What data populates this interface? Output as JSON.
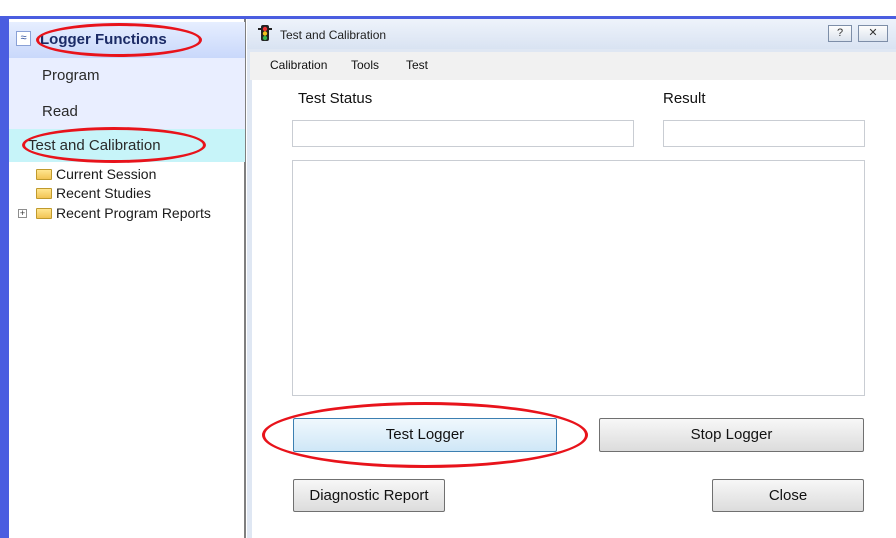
{
  "sidebar": {
    "header": {
      "collapse_glyph": "≈",
      "title": "Logger Functions"
    },
    "nav": [
      {
        "label": "Program"
      },
      {
        "label": "Read"
      },
      {
        "label": "Test and Calibration"
      }
    ],
    "tree": [
      {
        "label": "Current Session",
        "icon": "folder-icon"
      },
      {
        "label": "Recent Studies",
        "icon": "folder-icon"
      },
      {
        "label": "Recent Program Reports",
        "icon": "folder-icon",
        "expander": "+"
      }
    ]
  },
  "dialog": {
    "title": "Test and Calibration",
    "help_glyph": "?",
    "close_glyph": "✕",
    "menu": [
      "Calibration",
      "Tools",
      "Test"
    ],
    "test_status_label": "Test Status",
    "result_label": "Result",
    "test_status_value": "",
    "result_value": "",
    "log_text": "",
    "buttons": {
      "test_logger": "Test Logger",
      "stop_logger": "Stop Logger",
      "diagnostic_report": "Diagnostic Report",
      "close": "Close"
    }
  },
  "annotation_color": "#e8131b",
  "accent_color": "#4a5de0"
}
